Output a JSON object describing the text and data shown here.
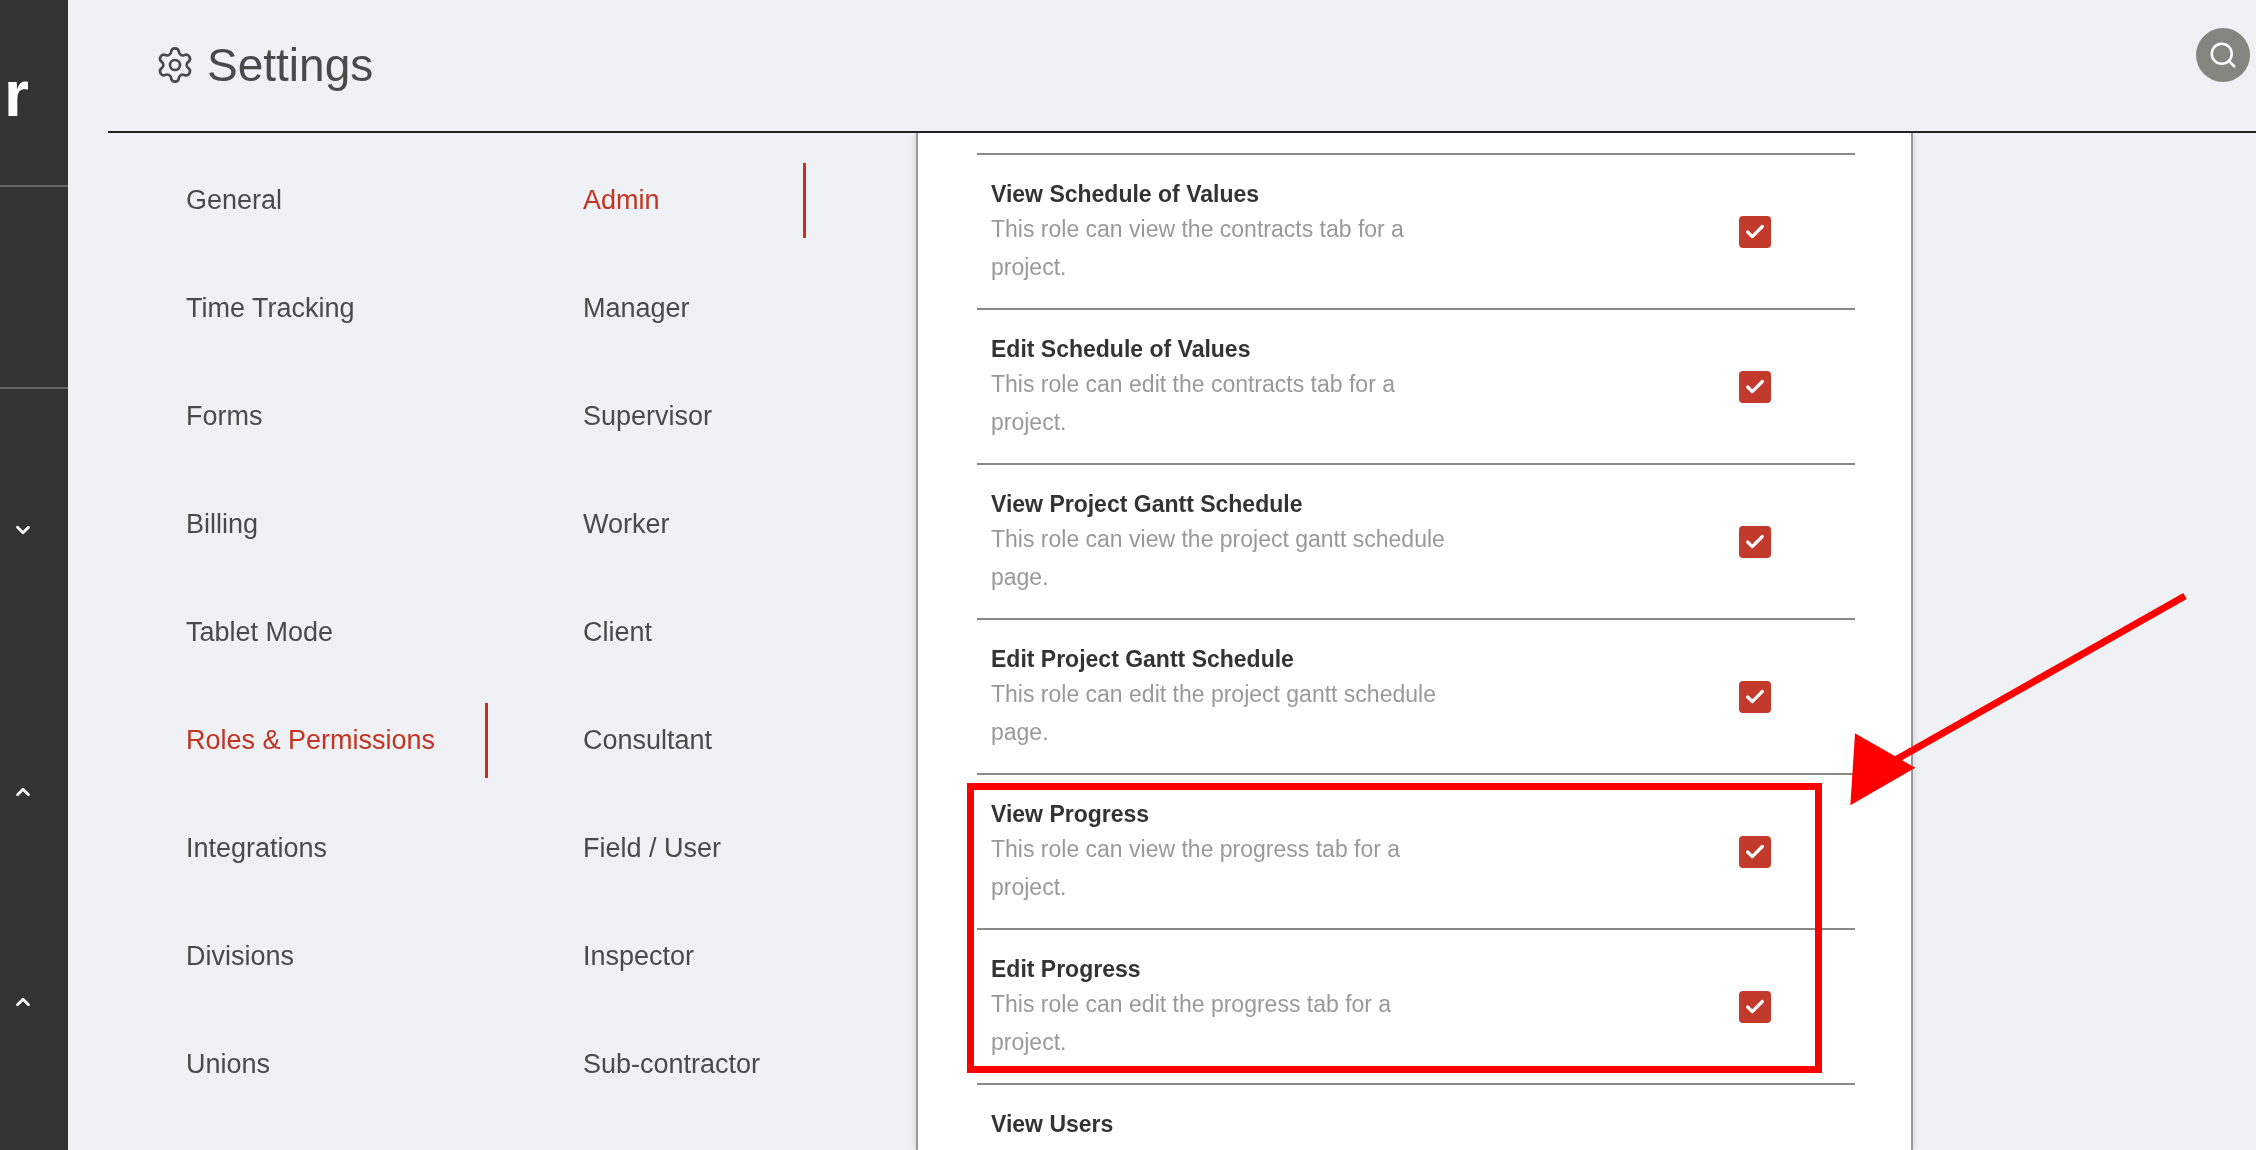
{
  "rail": {
    "logo": "r",
    "toggles": [
      {
        "expanded": false
      },
      {
        "expanded": true
      },
      {
        "expanded": true
      }
    ]
  },
  "header": {
    "title": "Settings"
  },
  "settings_nav": [
    {
      "label": "General",
      "selected": false
    },
    {
      "label": "Time Tracking",
      "selected": false
    },
    {
      "label": "Forms",
      "selected": false
    },
    {
      "label": "Billing",
      "selected": false
    },
    {
      "label": "Tablet Mode",
      "selected": false
    },
    {
      "label": "Roles & Permissions",
      "selected": true
    },
    {
      "label": "Integrations",
      "selected": false
    },
    {
      "label": "Divisions",
      "selected": false
    },
    {
      "label": "Unions",
      "selected": false
    }
  ],
  "roles": [
    {
      "label": "Admin",
      "selected": true
    },
    {
      "label": "Manager",
      "selected": false
    },
    {
      "label": "Supervisor",
      "selected": false
    },
    {
      "label": "Worker",
      "selected": false
    },
    {
      "label": "Client",
      "selected": false
    },
    {
      "label": "Consultant",
      "selected": false
    },
    {
      "label": "Field / User",
      "selected": false
    },
    {
      "label": "Inspector",
      "selected": false
    },
    {
      "label": "Sub-contractor",
      "selected": false
    }
  ],
  "permissions": [
    {
      "title": "View Schedule of Values",
      "description": "This role can view the contracts tab for a project.",
      "checked": true
    },
    {
      "title": "Edit Schedule of Values",
      "description": "This role can edit the contracts tab for a project.",
      "checked": true
    },
    {
      "title": "View Project Gantt Schedule",
      "description": "This role can view the project gantt schedule page.",
      "checked": true
    },
    {
      "title": "Edit Project Gantt Schedule",
      "description": "This role can edit the project gantt schedule page.",
      "checked": true
    },
    {
      "title": "View Progress",
      "description": "This role can view the progress tab for a project.",
      "checked": true
    },
    {
      "title": "Edit Progress",
      "description": "This role can edit the progress tab for a project.",
      "checked": true
    },
    {
      "title": "View Users"
    }
  ],
  "annotations": {
    "highlight_frame": true,
    "arrow": true
  }
}
